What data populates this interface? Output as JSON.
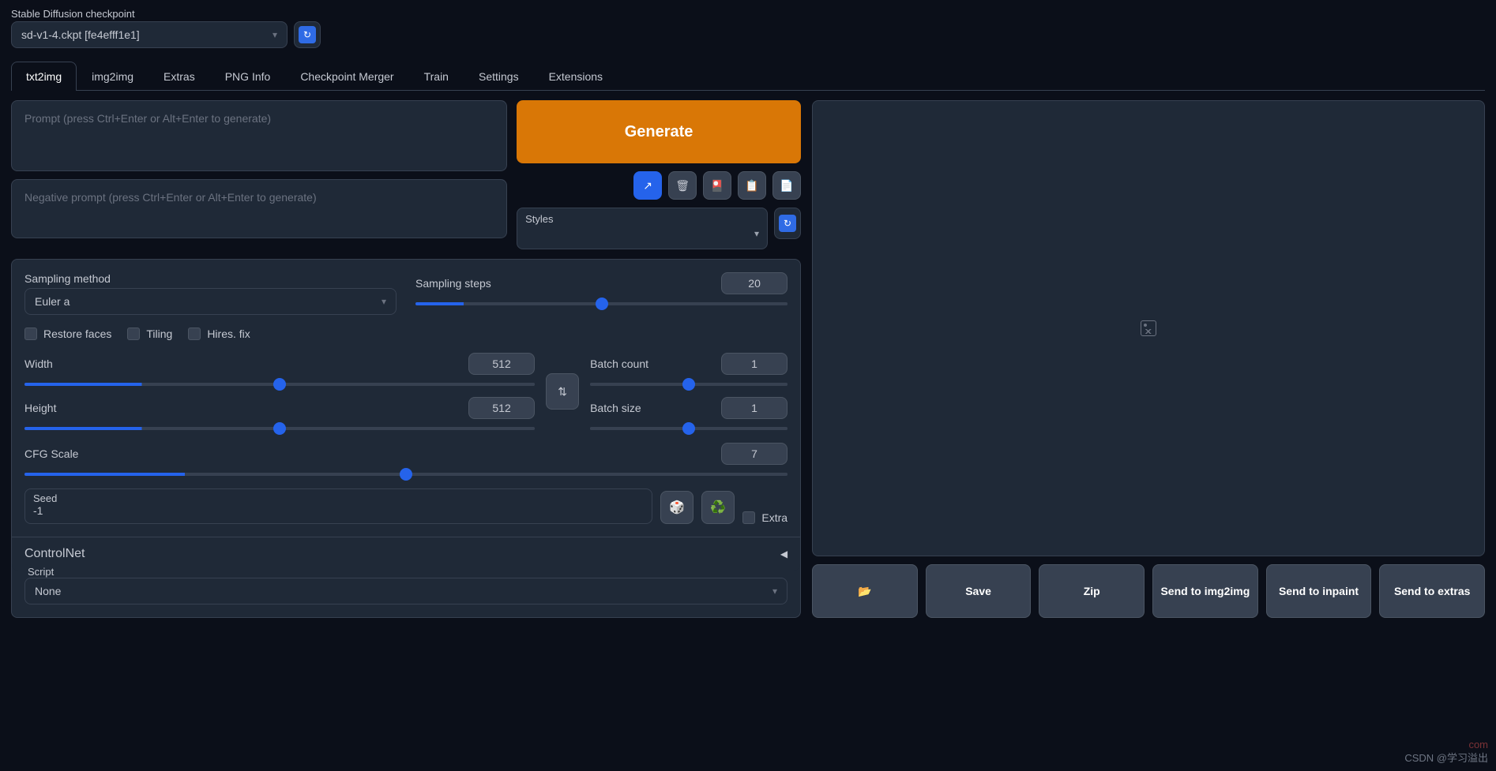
{
  "checkpoint": {
    "label": "Stable Diffusion checkpoint",
    "value": "sd-v1-4.ckpt [fe4efff1e1]"
  },
  "tabs": [
    "txt2img",
    "img2img",
    "Extras",
    "PNG Info",
    "Checkpoint Merger",
    "Train",
    "Settings",
    "Extensions"
  ],
  "activeTab": 0,
  "prompt": {
    "placeholder": "Prompt (press Ctrl+Enter or Alt+Enter to generate)",
    "value": ""
  },
  "negativePrompt": {
    "placeholder": "Negative prompt (press Ctrl+Enter or Alt+Enter to generate)",
    "value": ""
  },
  "generate": {
    "label": "Generate"
  },
  "toolIcons": {
    "arrow": "↗",
    "trash": "🗑",
    "card": "🎴",
    "clipboard": "📋",
    "file": "📄"
  },
  "styles": {
    "label": "Styles"
  },
  "sampling": {
    "methodLabel": "Sampling method",
    "methodValue": "Euler a",
    "stepsLabel": "Sampling steps",
    "stepsValue": "20",
    "stepsPct": 13
  },
  "checkboxes": {
    "restoreFaces": "Restore faces",
    "tiling": "Tiling",
    "hiresFix": "Hires. fix"
  },
  "dims": {
    "widthLabel": "Width",
    "widthValue": "512",
    "widthPct": 23,
    "heightLabel": "Height",
    "heightValue": "512",
    "heightPct": 23,
    "batchCountLabel": "Batch count",
    "batchCountValue": "1",
    "batchCountPct": 0,
    "batchSizeLabel": "Batch size",
    "batchSizeValue": "1",
    "batchSizePct": 0
  },
  "cfg": {
    "label": "CFG Scale",
    "value": "7",
    "pct": 21
  },
  "seed": {
    "label": "Seed",
    "value": "-1",
    "dice": "🎲",
    "recycle": "♻️",
    "extraLabel": "Extra"
  },
  "controlnet": {
    "label": "ControlNet"
  },
  "script": {
    "label": "Script",
    "value": "None"
  },
  "output": {
    "folder": "📂",
    "save": "Save",
    "zip": "Zip",
    "sendImg2img": "Send to img2img",
    "sendInpaint": "Send to inpaint",
    "sendExtras": "Send to extras"
  },
  "watermark": {
    "faint": "com",
    "main": "CSDN @学习溢出"
  }
}
